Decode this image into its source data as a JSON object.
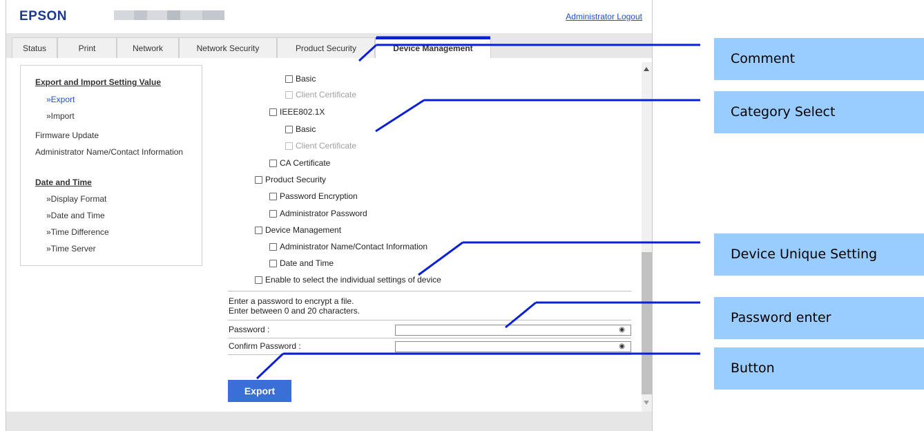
{
  "header": {
    "logo": "EPSON",
    "logout_link": "Administrator Logout"
  },
  "tabs": [
    "Status",
    "Print",
    "Network",
    "Network Security",
    "Product Security",
    "Device Management"
  ],
  "active_tab": "Device Management",
  "sidebar": {
    "export_import_heading": "Export and Import Setting Value",
    "export_link": "»Export",
    "import_link": "»Import",
    "firmware_update": "Firmware Update",
    "admin_name_contact": "Administrator Name/Contact Information",
    "date_time_heading": "Date and Time",
    "display_format": "»Display Format",
    "date_and_time": "»Date and Time",
    "time_difference": "»Time Difference",
    "time_server": "»Time Server"
  },
  "checkboxes": {
    "basic_1": "Basic",
    "client_cert_1": "Client Certificate",
    "ieee8021x": "IEEE802.1X",
    "basic_2": "Basic",
    "client_cert_2": "Client Certificate",
    "ca_certificate": "CA Certificate",
    "product_security": "Product Security",
    "password_encryption": "Password Encryption",
    "administrator_password": "Administrator Password",
    "device_management": "Device Management",
    "admin_name_contact_info": "Administrator Name/Contact Information",
    "date_and_time": "Date and Time",
    "enable_individual": "Enable to select the individual settings of device"
  },
  "password_section": {
    "instruction_1": "Enter a password to encrypt a file.",
    "instruction_2": "Enter between 0 and 20 characters.",
    "password_label": "Password :",
    "password_value": "",
    "confirm_label": "Confirm Password :",
    "confirm_value": ""
  },
  "export_button": "Export",
  "callouts": {
    "comment": "Comment",
    "category_select": "Category Select",
    "device_unique_setting": "Device Unique Setting",
    "password_enter": "Password enter",
    "button": "Button"
  },
  "colors": {
    "brand": "#1b3a8c",
    "link": "#1a4fd6",
    "button": "#3a6fd8",
    "callout": "#99ccff",
    "leader_line": "#0a1fd8"
  }
}
